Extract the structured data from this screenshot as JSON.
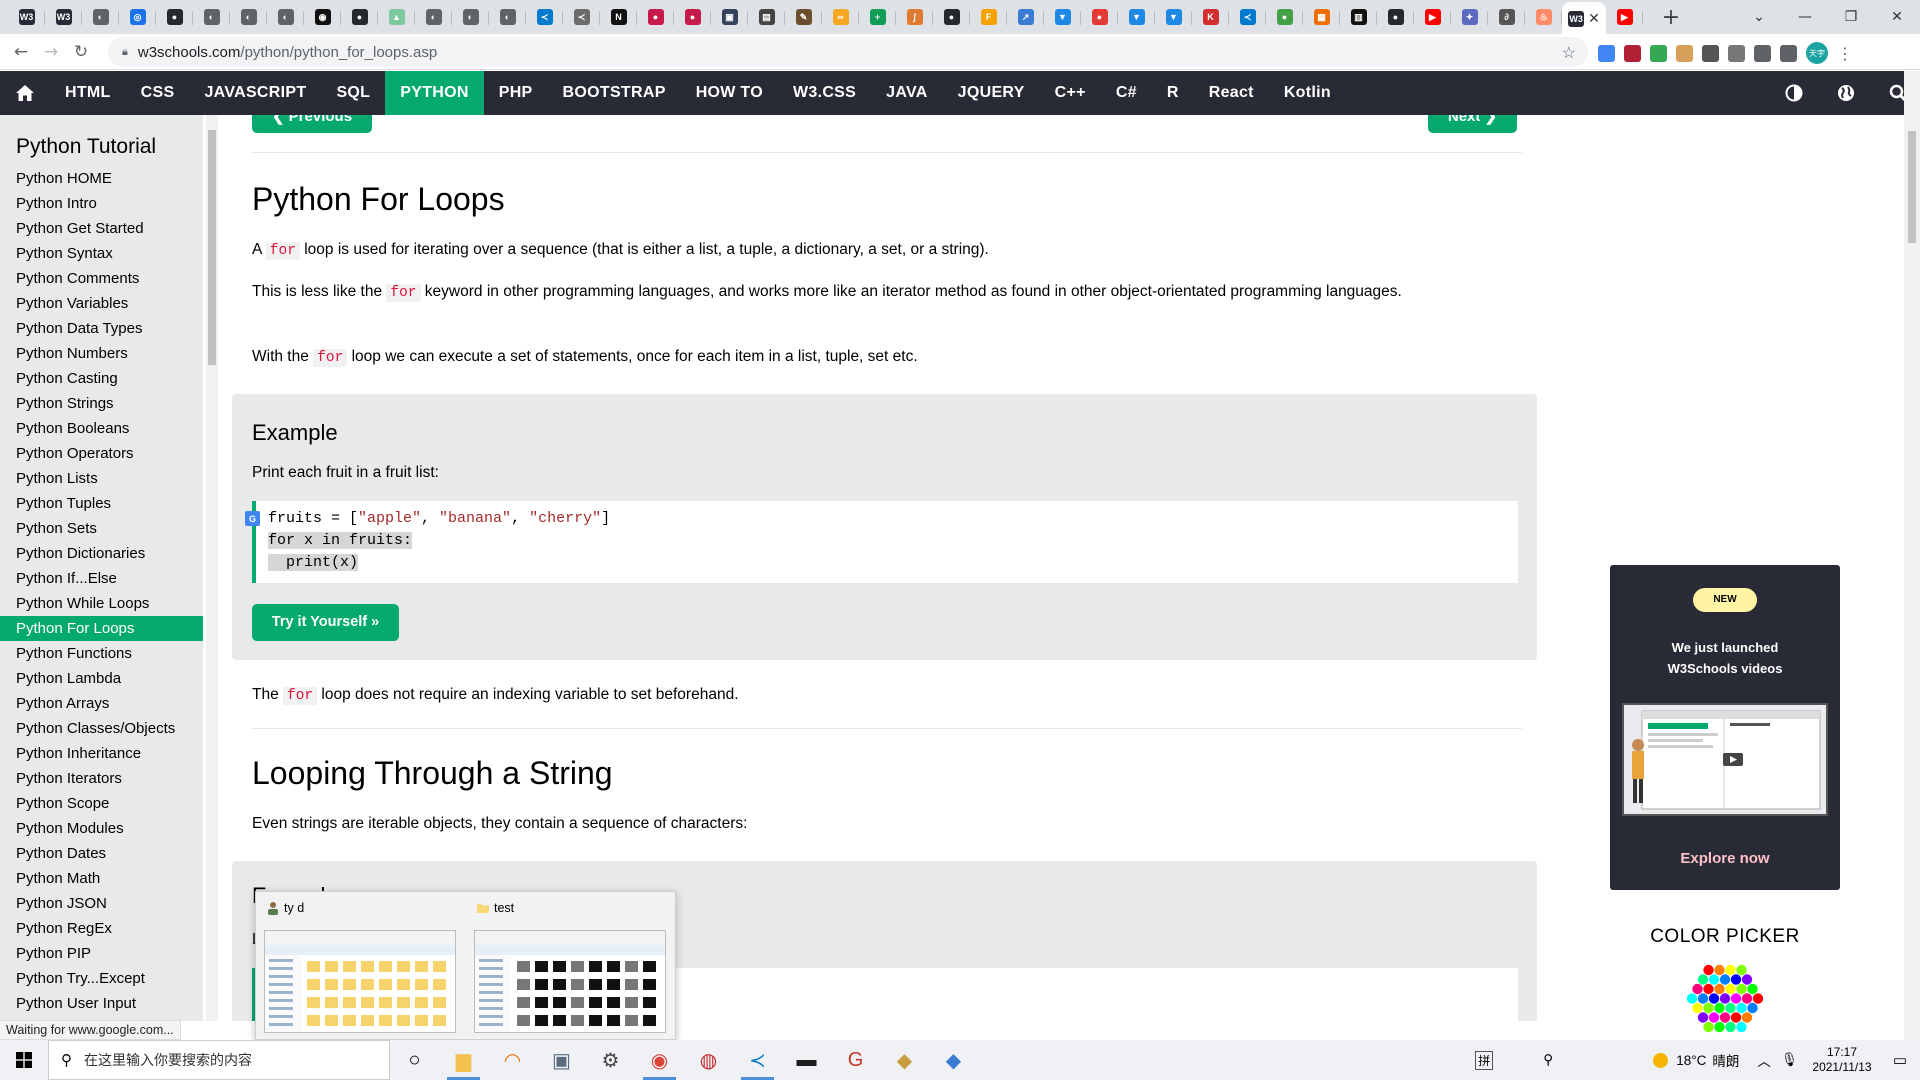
{
  "browser": {
    "tabs": [
      {
        "icon": "w3schools-favicon",
        "color": "#282a35",
        "glyph": "W3"
      },
      {
        "icon": "w3schools-favicon",
        "color": "#282a35",
        "glyph": "W3"
      },
      {
        "icon": "globe-favicon",
        "color": "#5f6368",
        "glyph": "◐"
      },
      {
        "icon": "blue-favicon",
        "color": "#1a73e8",
        "glyph": "◎"
      },
      {
        "icon": "github-favicon",
        "color": "#24292e",
        "glyph": "●"
      },
      {
        "icon": "globe-favicon",
        "color": "#5f6368",
        "glyph": "◐"
      },
      {
        "icon": "globe-favicon",
        "color": "#5f6368",
        "glyph": "◐"
      },
      {
        "icon": "globe-favicon",
        "color": "#5f6368",
        "glyph": "◐"
      },
      {
        "icon": "target-favicon",
        "color": "#111111",
        "glyph": "◉"
      },
      {
        "icon": "github-favicon",
        "color": "#24292e",
        "glyph": "●"
      },
      {
        "icon": "chart-favicon",
        "color": "#7ec8a0",
        "glyph": "▲"
      },
      {
        "icon": "globe-favicon",
        "color": "#5f6368",
        "glyph": "◐"
      },
      {
        "icon": "globe-favicon",
        "color": "#5f6368",
        "glyph": "◐"
      },
      {
        "icon": "globe-favicon",
        "color": "#5f6368",
        "glyph": "◐"
      },
      {
        "icon": "vscode-favicon",
        "color": "#007acc",
        "glyph": "≺"
      },
      {
        "icon": "vscode-favicon",
        "color": "#6b6b6b",
        "glyph": "≺"
      },
      {
        "icon": "notion-favicon",
        "color": "#111111",
        "glyph": "N"
      },
      {
        "icon": "raspberry-favicon",
        "color": "#c51a4a",
        "glyph": "●"
      },
      {
        "icon": "raspberry-favicon",
        "color": "#c51a4a",
        "glyph": "●"
      },
      {
        "icon": "tool-favicon",
        "color": "#33415c",
        "glyph": "▣"
      },
      {
        "icon": "book-favicon",
        "color": "#444444",
        "glyph": "▤"
      },
      {
        "icon": "pen-favicon",
        "color": "#6b4e2e",
        "glyph": "✎"
      },
      {
        "icon": "loop-favicon",
        "color": "#f5a623",
        "glyph": "∞"
      },
      {
        "icon": "plus-favicon",
        "color": "#0f9d58",
        "glyph": "+"
      },
      {
        "icon": "script-favicon",
        "color": "#e07a30",
        "glyph": "ʃ"
      },
      {
        "icon": "github-favicon",
        "color": "#24292e",
        "glyph": "●"
      },
      {
        "icon": "f-favicon",
        "color": "#f4a300",
        "glyph": "F"
      },
      {
        "icon": "arrow-favicon",
        "color": "#3a7bd5",
        "glyph": "↗"
      },
      {
        "icon": "filter-favicon",
        "color": "#1e88e5",
        "glyph": "▼"
      },
      {
        "icon": "red-dot-favicon",
        "color": "#e53935",
        "glyph": "●"
      },
      {
        "icon": "filter-favicon",
        "color": "#1e88e5",
        "glyph": "▼"
      },
      {
        "icon": "filter-favicon",
        "color": "#1e88e5",
        "glyph": "▼"
      },
      {
        "icon": "k-favicon",
        "color": "#d32f2f",
        "glyph": "K"
      },
      {
        "icon": "vscode-favicon",
        "color": "#007acc",
        "glyph": "≺"
      },
      {
        "icon": "green-circle-favicon",
        "color": "#43a047",
        "glyph": "●"
      },
      {
        "icon": "grid-favicon",
        "color": "#ef6c00",
        "glyph": "▦"
      },
      {
        "icon": "columns-favicon",
        "color": "#111111",
        "glyph": "▥"
      },
      {
        "icon": "github-favicon",
        "color": "#24292e",
        "glyph": "●"
      },
      {
        "icon": "youtube-favicon",
        "color": "#ff0000",
        "glyph": "▶"
      },
      {
        "icon": "puzzle-favicon",
        "color": "#5c6bc0",
        "glyph": "✦"
      },
      {
        "icon": "link-favicon",
        "color": "#555555",
        "glyph": "∂"
      },
      {
        "icon": "orange-favicon",
        "color": "#ff8a65",
        "glyph": "♨"
      }
    ],
    "active_tab": {
      "icon": "w3schools-favicon",
      "color": "#282a35",
      "glyph": "W3"
    },
    "after_active_tabs": [
      {
        "icon": "youtube-favicon",
        "color": "#ff0000",
        "glyph": "▶"
      }
    ],
    "new_tab_glyph": "+",
    "window_controls": [
      "⌄",
      "—",
      "❐",
      "✕"
    ],
    "url_host": "w3schools.com",
    "url_path": "/python/python_for_loops.asp",
    "extensions": [
      {
        "name": "translate-extension-icon",
        "color": "#4285f4"
      },
      {
        "name": "flag-extension-icon",
        "color": "#b22234"
      },
      {
        "name": "chrome-extension-icon",
        "color": "#34a853"
      },
      {
        "name": "cookie-extension-icon",
        "color": "#d7a05a"
      },
      {
        "name": "crx-extension-icon",
        "color": "#555555"
      },
      {
        "name": "image-extension-icon",
        "color": "#777777"
      },
      {
        "name": "puzzle-extension-icon",
        "color": "#5f6368"
      },
      {
        "name": "list-extension-icon",
        "color": "#5f6368"
      }
    ],
    "profile_label": "天宇",
    "status_text": "Waiting for www.google.com..."
  },
  "topnav": {
    "links": [
      "HTML",
      "CSS",
      "JAVASCRIPT",
      "SQL",
      "PYTHON",
      "PHP",
      "BOOTSTRAP",
      "HOW TO",
      "W3.CSS",
      "JAVA",
      "JQUERY",
      "C++",
      "C#",
      "R",
      "React",
      "Kotlin"
    ],
    "active": "PYTHON",
    "accent": "#04aa6d",
    "background": "#282a35"
  },
  "sidebar": {
    "title": "Python Tutorial",
    "items": [
      "Python HOME",
      "Python Intro",
      "Python Get Started",
      "Python Syntax",
      "Python Comments",
      "Python Variables",
      "Python Data Types",
      "Python Numbers",
      "Python Casting",
      "Python Strings",
      "Python Booleans",
      "Python Operators",
      "Python Lists",
      "Python Tuples",
      "Python Sets",
      "Python Dictionaries",
      "Python If...Else",
      "Python While Loops",
      "Python For Loops",
      "Python Functions",
      "Python Lambda",
      "Python Arrays",
      "Python Classes/Objects",
      "Python Inheritance",
      "Python Iterators",
      "Python Scope",
      "Python Modules",
      "Python Dates",
      "Python Math",
      "Python JSON",
      "Python RegEx",
      "Python PIP",
      "Python Try...Except",
      "Python User Input"
    ],
    "active": "Python For Loops"
  },
  "main": {
    "prev_label": "❮ Previous",
    "next_label": "Next ❯",
    "heading": "Python For Loops",
    "intro": [
      {
        "before": "A ",
        "code": "for",
        "after": " loop is used for iterating over a sequence (that is either a list, a tuple, a dictionary, a set, or a string)."
      },
      {
        "before": "This is less like the ",
        "code": "for",
        "after": " keyword in other programming languages, and works more like an iterator method as found in other object-orientated programming languages."
      },
      {
        "before": "With the ",
        "code": "for",
        "after": " loop we can execute a set of statements, once for each item in a list, tuple, set etc."
      }
    ],
    "example": {
      "heading": "Example",
      "description": "Print each fruit in a fruit list:",
      "code_lines": [
        "fruits = [\"apple\", \"banana\", \"cherry\"]",
        "for x in fruits:",
        "  print(x)"
      ],
      "try_label": "Try it Yourself »"
    },
    "after_example": {
      "before": "The ",
      "code": "for",
      "after": " loop does not require an indexing variable to set beforehand."
    },
    "heading2": "Looping Through a String",
    "para2": "Even strings are iterable objects, they contain a sequence of characters:",
    "example2_heading": "Example",
    "example2_description": "L"
  },
  "ad": {
    "badge": "NEW",
    "title_line1": "We just launched",
    "title_line2": "W3Schools videos",
    "cta": "Explore now"
  },
  "color_picker": {
    "title": "COLOR PICKER"
  },
  "thumbnails": [
    {
      "title": "ty d",
      "icon": "user-folder-icon"
    },
    {
      "title": "test",
      "icon": "folder-icon"
    }
  ],
  "taskbar": {
    "search_placeholder": "在这里输入你要搜索的内容",
    "apps": [
      {
        "name": "task-view-icon",
        "glyph": "○",
        "color": "#000000",
        "open": false
      },
      {
        "name": "file-explorer-icon",
        "glyph": "▆",
        "color": "#f2c14e",
        "open": true
      },
      {
        "name": "headset-app-icon",
        "glyph": "◠",
        "color": "#e8710a",
        "open": false
      },
      {
        "name": "monitor-app-icon",
        "glyph": "▣",
        "color": "#5a6b80",
        "open": false
      },
      {
        "name": "settings-icon",
        "glyph": "⚙",
        "color": "#444444",
        "open": false
      },
      {
        "name": "chrome-icon",
        "glyph": "◉",
        "color": "#db4437",
        "open": true
      },
      {
        "name": "recorder-app-icon",
        "glyph": "◍",
        "color": "#c62828",
        "open": false
      },
      {
        "name": "vscode-icon",
        "glyph": "≺",
        "color": "#007acc",
        "open": true
      },
      {
        "name": "terminal-icon",
        "glyph": "▬",
        "color": "#1e1e1e",
        "open": false
      },
      {
        "name": "g-app-icon",
        "glyph": "G",
        "color": "#c0392b",
        "open": false
      },
      {
        "name": "league-app-icon",
        "glyph": "◆",
        "color": "#c89b3c",
        "open": false
      },
      {
        "name": "league-launcher-icon",
        "glyph": "◆",
        "color": "#3a7bd5",
        "open": false
      }
    ],
    "ime_glyph": "拼",
    "weather_temp": "18°C",
    "weather_text": "晴朗",
    "time": "17:17",
    "date": "2021/11/13"
  }
}
